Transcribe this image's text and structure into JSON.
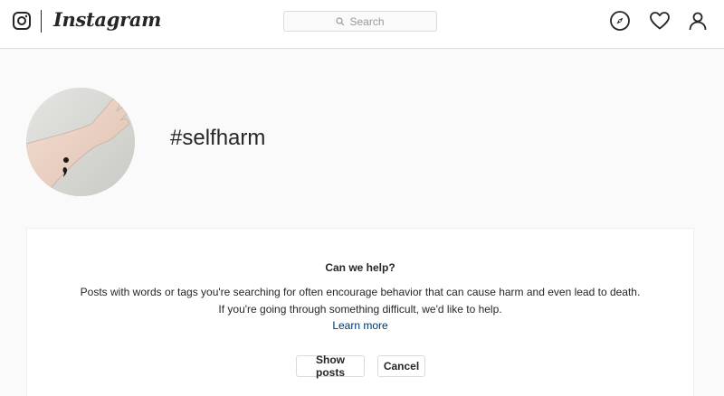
{
  "header": {
    "brand": "Instagram",
    "search": {
      "placeholder": "Search"
    },
    "icons": [
      "instagram-camera-icon",
      "compass-icon",
      "heart-icon",
      "profile-icon"
    ]
  },
  "hashtag": {
    "title": "#selfharm",
    "avatar_icon": "wrist-semicolon-photo"
  },
  "help": {
    "title": "Can we help?",
    "line1": "Posts with words or tags you're searching for often encourage behavior that can cause harm and even lead to death.",
    "line2": "If you're going through something difficult, we'd like to help.",
    "learn_more": "Learn more",
    "show_posts_label": "Show posts",
    "cancel_label": "Cancel"
  },
  "colors": {
    "page_bg": "#fafafa",
    "card_bg": "#ffffff",
    "border": "#dbdbdb",
    "text": "#262626",
    "link": "#003569",
    "muted": "#999999"
  }
}
